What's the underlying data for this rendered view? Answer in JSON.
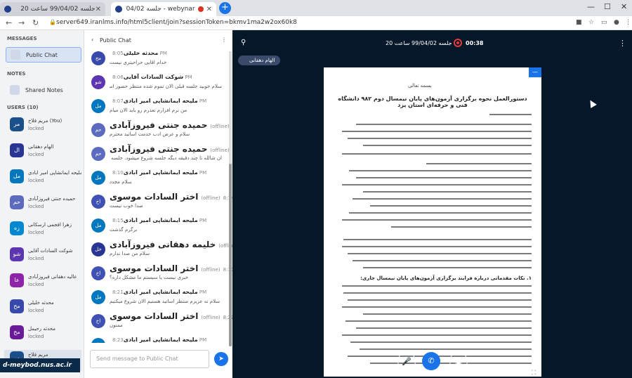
{
  "browser": {
    "tabs": [
      {
        "title": "جلسه 99/04/02 ساعت 20"
      },
      {
        "title": "webynar - جلسه 99/04/02 ساعت 20"
      }
    ],
    "url": "server649.iranlms.info/html5client/join?sessionToken=bkmv1ma2w2ox60k8"
  },
  "sidebar": {
    "messages_header": "MESSAGES",
    "public_chat": "Public Chat",
    "notes_header": "NOTES",
    "shared_notes": "Shared Notes",
    "users_header": "USERS (10)",
    "users": [
      {
        "name": "مریم فلاح (You)",
        "initials": "مر",
        "color": "#1a4f8a"
      },
      {
        "name": "الهام دهقانی",
        "initials": "ال",
        "color": "#283593"
      },
      {
        "name": "ملیحه ایمانشاپی امیر ابادی",
        "initials": "مل",
        "color": "#0277bd"
      },
      {
        "name": "حمیده جنتی فیروزآبادی",
        "initials": "حم",
        "color": "#5c6bc0"
      },
      {
        "name": "زهرا افجمی ارسکانی",
        "initials": "زه",
        "color": "#0288d1"
      },
      {
        "name": "شوکت السادات آقایی",
        "initials": "شو",
        "color": "#5e35b1"
      },
      {
        "name": "عالیه دهقانی فیروزآبادی",
        "initials": "عا",
        "color": "#8e24aa"
      },
      {
        "name": "محدثه خلیلی",
        "initials": "مح",
        "color": "#3949ab"
      },
      {
        "name": "محدثه رحیمل",
        "initials": "مح",
        "color": "#6a1b9a"
      },
      {
        "name": "مریم فلاح",
        "initials": "مر",
        "color": "#1a4f8a"
      }
    ],
    "locked": "locked"
  },
  "chat": {
    "header": "Public Chat",
    "messages": [
      {
        "name": "محدثه خلیلی",
        "time": "8:05 PM",
        "text": "خدام اقایی جراحیتری نیست",
        "initials": "مح",
        "color": "#3949ab",
        "big": false
      },
      {
        "name": "شوکت السادات آقایی",
        "time": "8:06 PM",
        "text": "سلام خوبید جلسه قبلی الان تموم شده منتظر حضور اساتید گرامی هستیم",
        "initials": "شو",
        "color": "#5e35b1",
        "big": false
      },
      {
        "name": "ملیحه ایمانشاپی امیر ابادی",
        "time": "8:07 PM",
        "text": "من نرم افزارم تعذرم رو باید الان میام",
        "initials": "مل",
        "color": "#0277bd",
        "big": false
      },
      {
        "name": "حمیده جنتی فیروزآبادی",
        "time": "8:07 PM",
        "text": "سلام و عرض ادب خدمت اساتید محترم",
        "initials": "حم",
        "color": "#5c6bc0",
        "big": true,
        "offline": "(offline)"
      },
      {
        "name": "حمیده جنتی فیروزآبادی",
        "time": "8:08 PM",
        "text": "ان شالله تا چند دقیقه دیگه جلسه شروع میشود. جلسه ی قبلی تازه",
        "initials": "حم",
        "color": "#5c6bc0",
        "big": true,
        "offline": "(offline)"
      },
      {
        "name": "ملیحه ایمانشاپی امیر ابادی",
        "time": "8:10 PM",
        "text": "سلام مجدد",
        "initials": "مل",
        "color": "#0277bd",
        "big": false
      },
      {
        "name": "اختر السادات موسوی",
        "time": "8:14 PM",
        "text": "صدا خوب نیست",
        "initials": "اخ",
        "color": "#3f51b5",
        "big": true,
        "offline": "(offline)"
      },
      {
        "name": "ملیحه ایمانشاپی امیر ابادی",
        "time": "8:15 PM",
        "text": "برگرم گذشت",
        "initials": "مل",
        "color": "#0277bd",
        "big": false
      },
      {
        "name": "خلیمه دهقانی فیروزآبادی",
        "time": "8:16 PM",
        "text": "سلام من صدا ندارم",
        "initials": "خل",
        "color": "#283593",
        "big": true,
        "offline": "(offline)"
      },
      {
        "name": "اختر السادات موسوی",
        "time": "8:17 PM",
        "text": "خبری نیست یا سیستم ما مشکل داره؟",
        "initials": "اخ",
        "color": "#3f51b5",
        "big": true,
        "offline": "(offline)"
      },
      {
        "name": "ملیحه ایمانشاپی امیر ابادی",
        "time": "8:21 PM",
        "text": "سلام ته عزیزم منتظر اساتید هستیم الان شروع میکنیم",
        "initials": "مل",
        "color": "#0277bd",
        "big": false
      },
      {
        "name": "اختر السادات موسوی",
        "time": "8:22 PM",
        "text": "ممنون",
        "initials": "اخ",
        "color": "#3f51b5",
        "big": true,
        "offline": "(offline)"
      },
      {
        "name": "ملیحه ایمانشاپی امیر ابادی",
        "time": "8:23 PM",
        "text": "صدا خرابه .......مرقلزه",
        "initials": "مل",
        "color": "#0277bd",
        "big": false
      }
    ],
    "input_placeholder": "Send message to Public Chat"
  },
  "meeting": {
    "title": "جلسه 99/04/02 ساعت 20",
    "timer": "00:38",
    "presenter": "الهام دهقانی",
    "document": {
      "heading": "دستورالعمل نحوه برگزاری آزمون‌های پایان نیمسال دوم ۹۸۲ دانشگاه فنی و حرفه‌ای استان یزد",
      "subheading": "بسمه تعالی",
      "section_title": "۱. نکات مقدماتی درباره فرایند برگزاری آزمون‌های پایان نیمسال جاری:"
    }
  },
  "watermark": "d-meybod.nus.ac.ir"
}
